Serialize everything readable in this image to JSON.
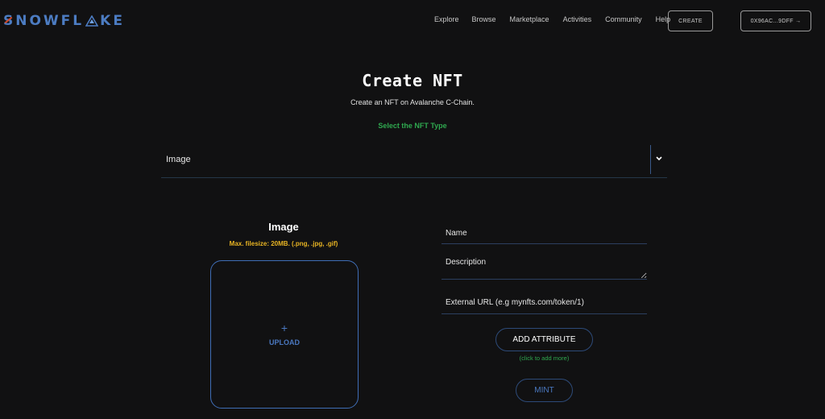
{
  "brand": {
    "name": "SNOWFLAKE",
    "prefix": "S",
    "part1": "NOWFL",
    "part2": "KE"
  },
  "nav": {
    "links": [
      "Explore",
      "Browse",
      "Marketplace",
      "Activities",
      "Community",
      "Help"
    ],
    "create_label": "CREATE",
    "wallet_label": "0X96AC...9DFF →"
  },
  "page": {
    "title": "Create NFT",
    "subtitle": "Create an NFT on Avalanche C-Chain.",
    "type_label": "Select the NFT Type",
    "type_selected": "Image",
    "chevron": "⌄"
  },
  "upload": {
    "heading": "Image",
    "hint": "Max. filesize: 20MB. (.png, .jpg, .gif)",
    "plus": "+",
    "label": "UPLOAD"
  },
  "form": {
    "name_placeholder": "Name",
    "description_placeholder": "Description",
    "url_placeholder": "External URL (e.g mynfts.com/token/1)",
    "add_attribute_label": "ADD ATTRIBUTE",
    "add_attribute_hint": "(click to add more)",
    "mint_label": "MINT"
  },
  "colors": {
    "accent_blue": "#3f6db5",
    "green": "#2fa84f",
    "yellow": "#e8b423",
    "background": "#111112"
  }
}
